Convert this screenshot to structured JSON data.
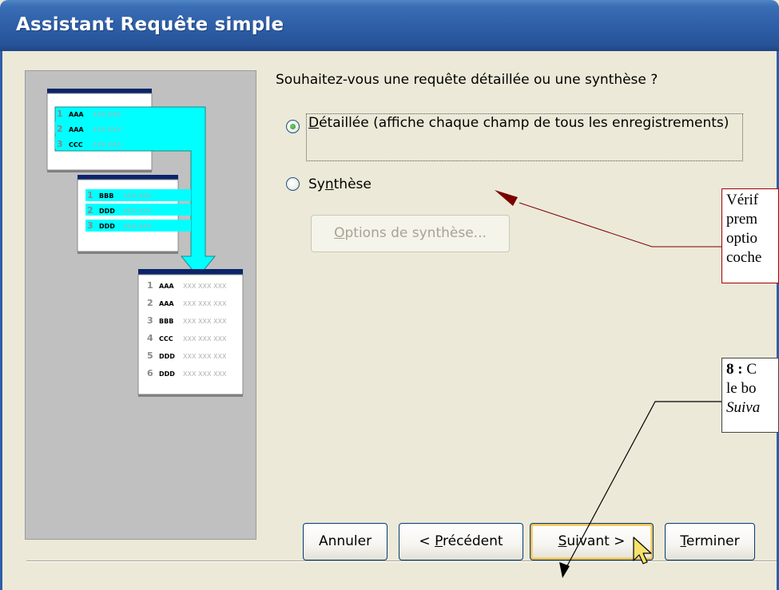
{
  "window": {
    "title": "Assistant Requête simple"
  },
  "wizard": {
    "question": "Souhaitez-vous une requête détaillée ou une synthèse ?",
    "options": [
      {
        "label_prefix": "",
        "label_mnemonic": "D",
        "label_rest": "étaillée (affiche chaque champ de tous les enregistrements)",
        "selected": true
      },
      {
        "label_prefix": "Sy",
        "label_mnemonic": "n",
        "label_rest": "thèse",
        "selected": false
      }
    ],
    "summary_options_button": {
      "label_mnemonic": "O",
      "label_rest": "ptions de synthèse...",
      "enabled": false
    }
  },
  "illustration": {
    "table1": {
      "rows": [
        {
          "n": "1",
          "key": "AAA",
          "rest": "XXX XXX"
        },
        {
          "n": "2",
          "key": "AAA",
          "rest": "XXX XXX"
        },
        {
          "n": "3",
          "key": "CCC",
          "rest": "XXX XXX"
        }
      ]
    },
    "table2": {
      "rows": [
        {
          "n": "1",
          "key": "BBB",
          "rest": "XXX XXX"
        },
        {
          "n": "2",
          "key": "DDD",
          "rest": "XXX XXX"
        },
        {
          "n": "3",
          "key": "DDD",
          "rest": "XXX XXX"
        }
      ]
    },
    "result": {
      "rows": [
        {
          "n": "1",
          "key": "AAA",
          "rest": "XXX XXX XXX"
        },
        {
          "n": "2",
          "key": "AAA",
          "rest": "XXX XXX XXX"
        },
        {
          "n": "3",
          "key": "BBB",
          "rest": "XXX XXX XXX"
        },
        {
          "n": "4",
          "key": "CCC",
          "rest": "XXX XXX XXX"
        },
        {
          "n": "5",
          "key": "DDD",
          "rest": "XXX XXX XXX"
        },
        {
          "n": "6",
          "key": "DDD",
          "rest": "XXX XXX XXX"
        }
      ]
    }
  },
  "buttons": {
    "cancel": "Annuler",
    "previous_prefix": "< ",
    "previous_mnemonic": "P",
    "previous_rest": "récédent",
    "next_prefix": "",
    "next_mnemonic": "S",
    "next_rest": "uivant >",
    "finish_mnemonic": "T",
    "finish_rest": "erminer"
  },
  "callouts": {
    "verify_lines": [
      "Vérif",
      "prem",
      "optio",
      "coche"
    ],
    "step8_bold": "8 :",
    "step8_line1_rest": " C",
    "step8_line2": "le bo",
    "step8_line3_italic": "Suiva"
  },
  "colors": {
    "title_bar": "#2E5FA8",
    "dialog_bg": "#ECE9D8",
    "illustration_bg": "#C0C0C0",
    "table_header": "#0A246A",
    "cyan_highlight": "#00FFFF",
    "radio_dot": "#2A9A2A",
    "callout_border": "#A00000"
  }
}
